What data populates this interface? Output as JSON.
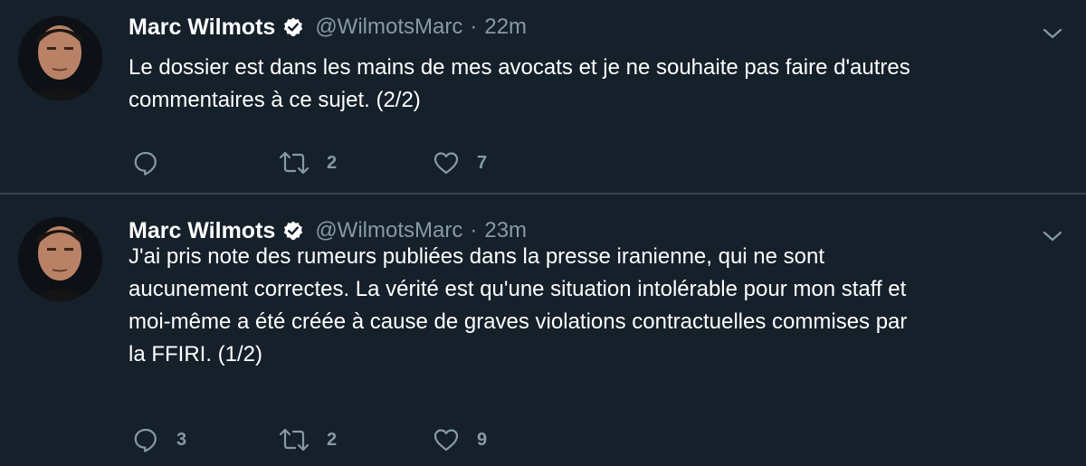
{
  "colors": {
    "background": "#15202b",
    "divider": "#38444d",
    "primary_text": "#ffffff",
    "secondary_text": "#8899a6"
  },
  "tweets": [
    {
      "author_name": "Marc Wilmots",
      "handle": "@WilmotsMarc",
      "separator": "·",
      "time": "22m",
      "verified_icon": "verified-badge-icon",
      "text_lines": [
        "Le dossier est dans les mains de mes avocats et je ne souhaite pas faire d'autres",
        "commentaires à ce sujet. (2/2)"
      ],
      "reply_count": "",
      "retweet_count": "2",
      "like_count": "7"
    },
    {
      "author_name": "Marc Wilmots",
      "handle": "@WilmotsMarc",
      "separator": "·",
      "time": "23m",
      "verified_icon": "verified-badge-icon",
      "text_lines": [
        "J'ai pris note des rumeurs publiées dans la presse iranienne, qui ne sont",
        "aucunement correctes. La vérité est qu'une situation intolérable pour mon staff et",
        "moi-même a été créée à cause de graves violations contractuelles commises par",
        "la FFIRI. (1/2)"
      ],
      "reply_count": "3",
      "retweet_count": "2",
      "like_count": "9"
    }
  ]
}
